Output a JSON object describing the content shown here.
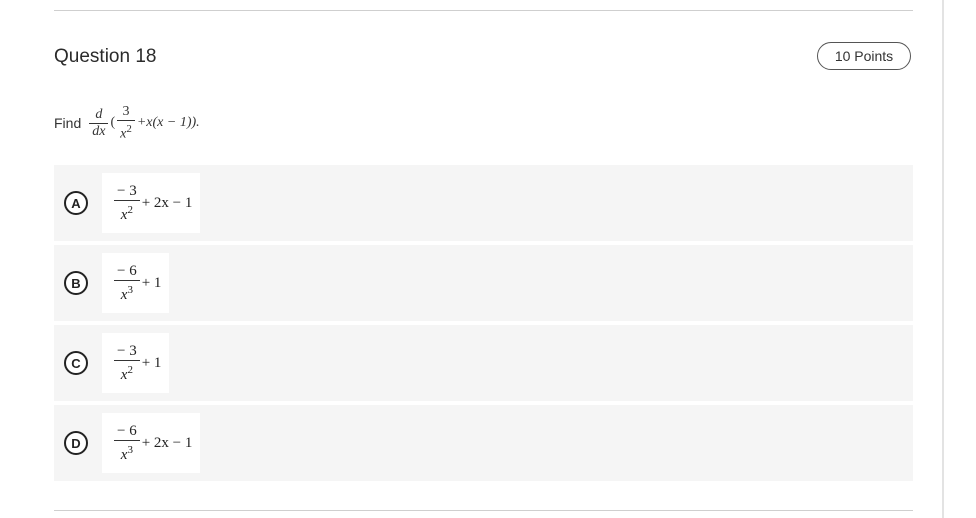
{
  "question": {
    "title": "Question 18",
    "points": "10 Points",
    "prompt": {
      "find": "Find",
      "d": "d",
      "dx": "dx",
      "open": "(",
      "three": "3",
      "x": "x",
      "two": "2",
      "rest": "+x(x − 1)).",
      "close": ""
    }
  },
  "options": [
    {
      "letter": "A",
      "num": "− 3",
      "den": "x",
      "exp": "2",
      "tail": "+ 2x − 1"
    },
    {
      "letter": "B",
      "num": "− 6",
      "den": "x",
      "exp": "3",
      "tail": "+ 1"
    },
    {
      "letter": "C",
      "num": "− 3",
      "den": "x",
      "exp": "2",
      "tail": "+ 1"
    },
    {
      "letter": "D",
      "num": "− 6",
      "den": "x",
      "exp": "3",
      "tail": "+ 2x − 1"
    }
  ]
}
